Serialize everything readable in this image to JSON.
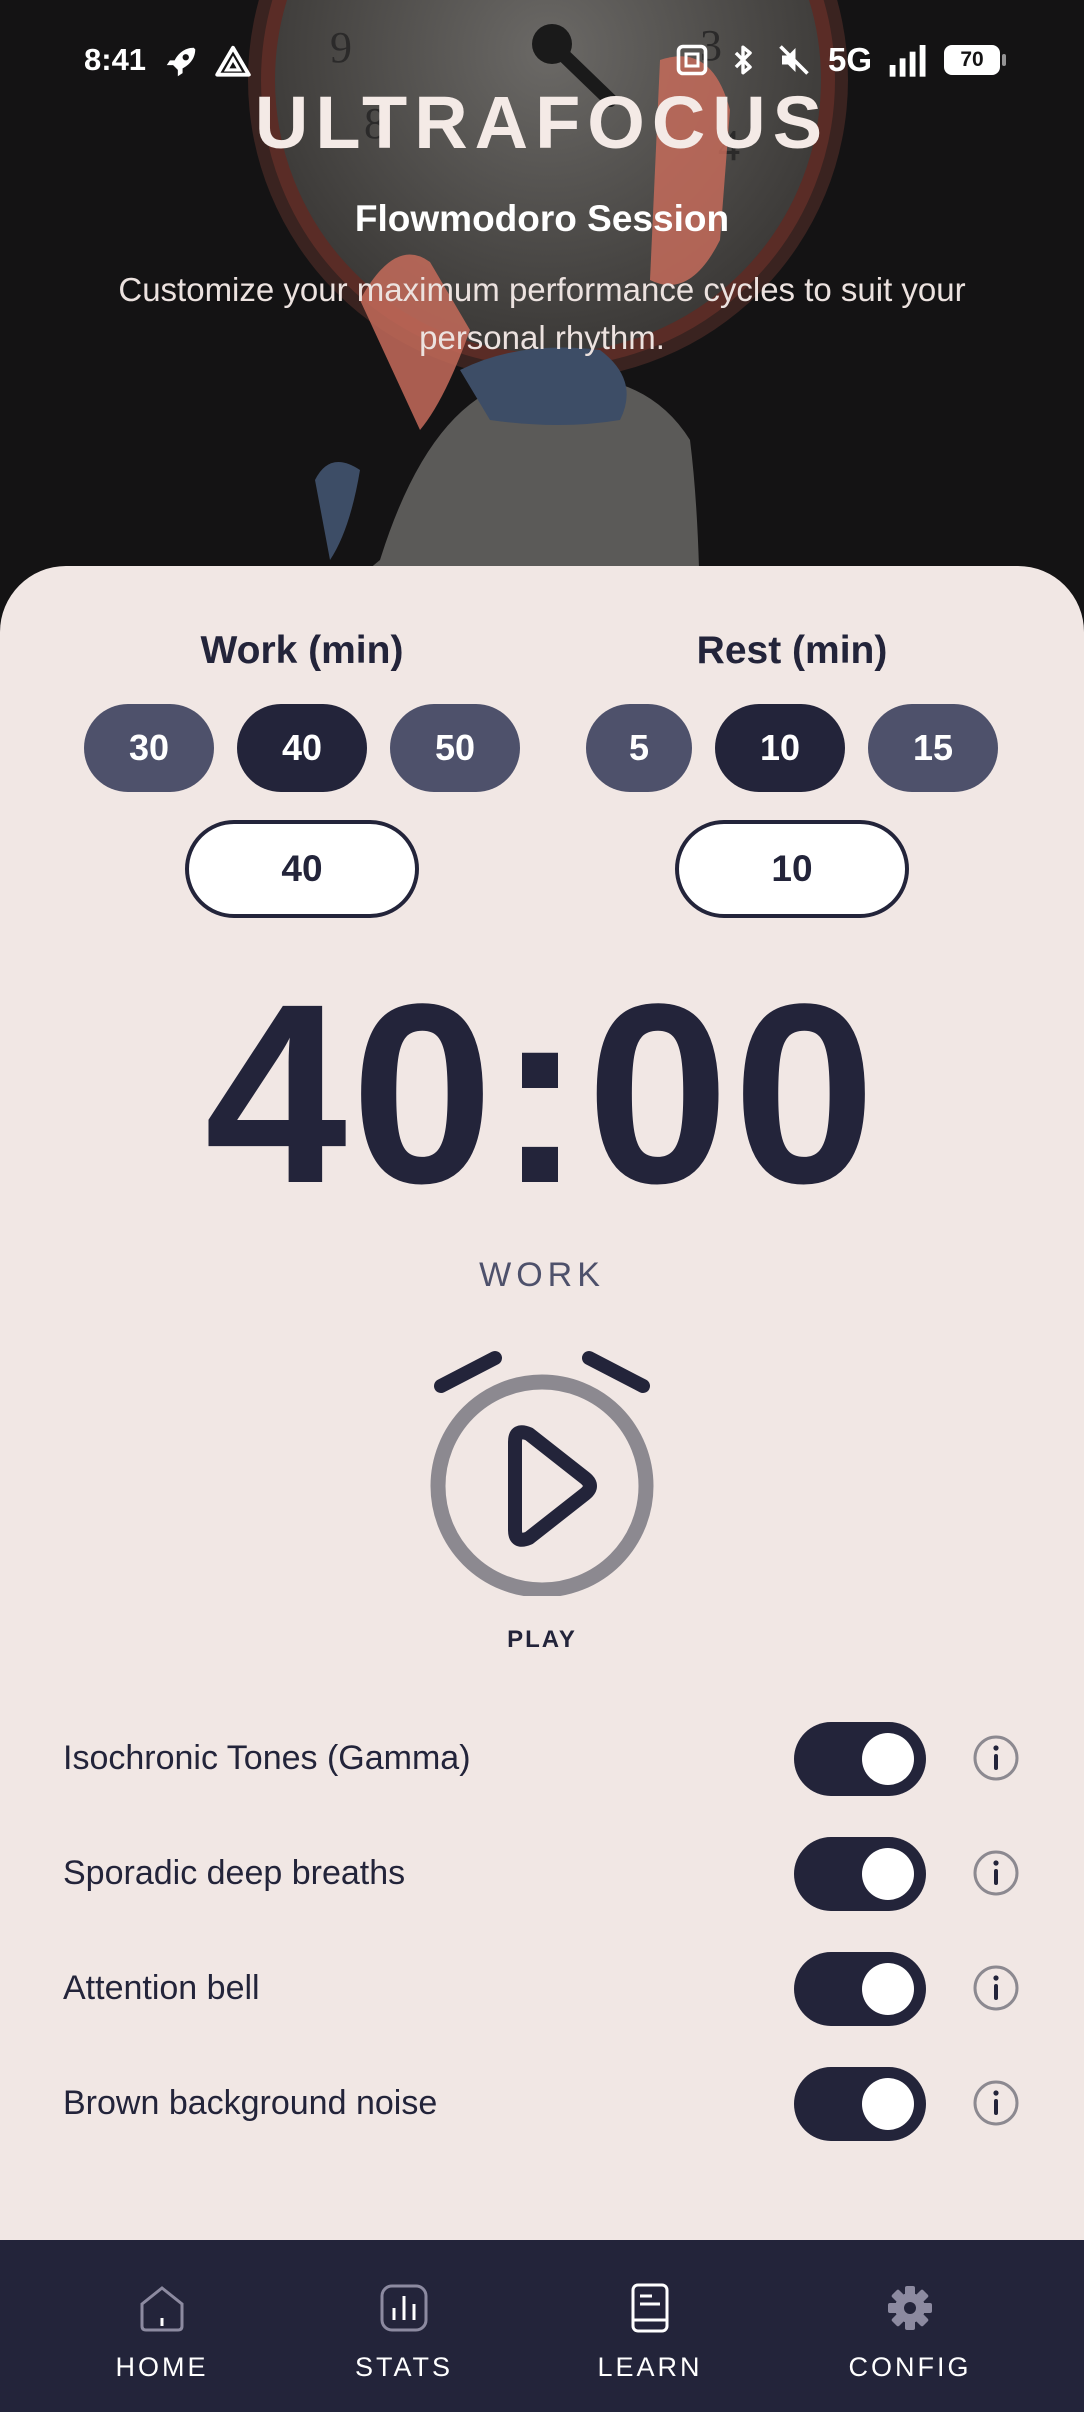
{
  "status_bar": {
    "time": "8:41",
    "left_icons": [
      "rocket-icon",
      "drive-icon"
    ],
    "right_icons": [
      "nfc-icon",
      "bluetooth-icon",
      "mute-icon",
      "signal-icon"
    ],
    "network": "5G",
    "battery": "70"
  },
  "header": {
    "app_title": "ULTRAFOCUS",
    "session_title": "Flowmodoro Session",
    "description": "Customize your maximum performance cycles to suit your personal rhythm."
  },
  "work": {
    "label": "Work (min)",
    "presets": [
      "30",
      "40",
      "50"
    ],
    "selected_preset": "40",
    "value": "40"
  },
  "rest": {
    "label": "Rest (min)",
    "presets": [
      "5",
      "10",
      "15"
    ],
    "selected_preset": "10",
    "value": "10"
  },
  "timer": {
    "display": "40:00",
    "phase": "WORK"
  },
  "play": {
    "label": "PLAY",
    "icon": "stopwatch-play-icon"
  },
  "options": [
    {
      "label": "Isochronic Tones (Gamma)",
      "enabled": true
    },
    {
      "label": "Sporadic deep breaths",
      "enabled": true
    },
    {
      "label": "Attention bell",
      "enabled": true
    },
    {
      "label": "Brown background noise",
      "enabled": true
    }
  ],
  "nav": [
    {
      "label": "HOME",
      "icon": "home-icon"
    },
    {
      "label": "STATS",
      "icon": "stats-icon"
    },
    {
      "label": "LEARN",
      "icon": "book-icon"
    },
    {
      "label": "CONFIG",
      "icon": "gear-icon"
    }
  ],
  "colors": {
    "primary": "#23243a",
    "chip": "#4e516b",
    "background": "#f1e7e4",
    "hero": "#141314"
  }
}
